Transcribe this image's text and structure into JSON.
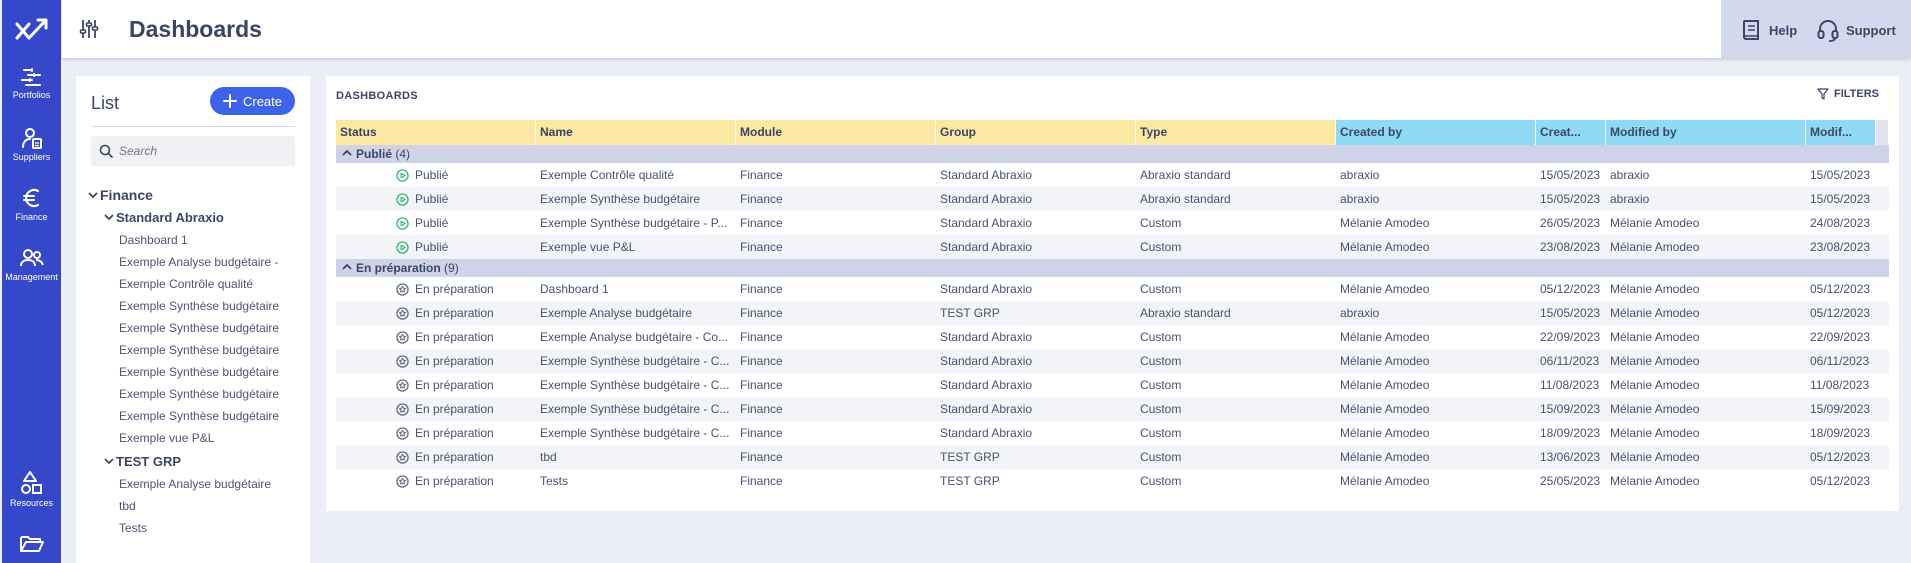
{
  "nav": {
    "items": [
      {
        "label": "Portfolios",
        "icon": "portfolios-icon"
      },
      {
        "label": "Suppliers",
        "icon": "suppliers-icon"
      },
      {
        "label": "Finance",
        "icon": "euro-icon"
      },
      {
        "label": "Management",
        "icon": "people-icon"
      }
    ],
    "bottom": [
      {
        "label": "Resources",
        "icon": "shapes-icon"
      },
      {
        "label": "",
        "icon": "folder-open-icon"
      }
    ]
  },
  "topbar": {
    "title": "Dashboards",
    "help_label": "Help",
    "support_label": "Support"
  },
  "list": {
    "title": "List",
    "create_label": "Create",
    "search_placeholder": "Search",
    "tree": {
      "root": "Finance",
      "groups": [
        {
          "name": "Standard Abraxio",
          "items": [
            "Dashboard 1",
            "Exemple Analyse budgétaire -",
            "Exemple Contrôle qualité",
            "Exemple Synthèse budgétaire",
            "Exemple Synthèse budgétaire",
            "Exemple Synthèse budgétaire",
            "Exemple Synthèse budgétaire",
            "Exemple Synthèse budgétaire",
            "Exemple Synthèse budgétaire",
            "Exemple vue P&L"
          ]
        },
        {
          "name": "TEST GRP",
          "items": [
            "Exemple Analyse budgétaire",
            "tbd",
            "Tests"
          ]
        }
      ]
    }
  },
  "main": {
    "title": "DASHBOARDS",
    "filters_label": "FILTERS",
    "columns": [
      "Status",
      "Name",
      "Module",
      "Group",
      "Type",
      "Created by",
      "Creat...",
      "Modified by",
      "Modif..."
    ],
    "groups": [
      {
        "label": "Publié",
        "count": "(4)",
        "rows": [
          [
            "Publié",
            "Exemple Contrôle qualité",
            "Finance",
            "Standard Abraxio",
            "Abraxio standard",
            "abraxio",
            "15/05/2023",
            "abraxio",
            "15/05/2023"
          ],
          [
            "Publié",
            "Exemple Synthèse budgétaire",
            "Finance",
            "Standard Abraxio",
            "Abraxio standard",
            "abraxio",
            "15/05/2023",
            "abraxio",
            "15/05/2023"
          ],
          [
            "Publié",
            "Exemple Synthèse budgétaire - P...",
            "Finance",
            "Standard Abraxio",
            "Custom",
            "Mélanie Amodeo",
            "26/05/2023",
            "Mélanie Amodeo",
            "24/08/2023"
          ],
          [
            "Publié",
            "Exemple vue P&L",
            "Finance",
            "Standard Abraxio",
            "Custom",
            "Mélanie Amodeo",
            "23/08/2023",
            "Mélanie Amodeo",
            "23/08/2023"
          ]
        ]
      },
      {
        "label": "En préparation",
        "count": "(9)",
        "rows": [
          [
            "En préparation",
            "Dashboard 1",
            "Finance",
            "Standard Abraxio",
            "Custom",
            "Mélanie Amodeo",
            "05/12/2023",
            "Mélanie Amodeo",
            "05/12/2023"
          ],
          [
            "En préparation",
            "Exemple Analyse budgétaire",
            "Finance",
            "TEST GRP",
            "Abraxio standard",
            "abraxio",
            "15/05/2023",
            "Mélanie Amodeo",
            "05/12/2023"
          ],
          [
            "En préparation",
            "Exemple Analyse budgétaire - Co...",
            "Finance",
            "Standard Abraxio",
            "Custom",
            "Mélanie Amodeo",
            "22/09/2023",
            "Mélanie Amodeo",
            "22/09/2023"
          ],
          [
            "En préparation",
            "Exemple Synthèse budgétaire - C...",
            "Finance",
            "Standard Abraxio",
            "Custom",
            "Mélanie Amodeo",
            "06/11/2023",
            "Mélanie Amodeo",
            "06/11/2023"
          ],
          [
            "En préparation",
            "Exemple Synthèse budgétaire - C...",
            "Finance",
            "Standard Abraxio",
            "Custom",
            "Mélanie Amodeo",
            "11/08/2023",
            "Mélanie Amodeo",
            "11/08/2023"
          ],
          [
            "En préparation",
            "Exemple Synthèse budgétaire - C...",
            "Finance",
            "Standard Abraxio",
            "Custom",
            "Mélanie Amodeo",
            "15/09/2023",
            "Mélanie Amodeo",
            "15/09/2023"
          ],
          [
            "En préparation",
            "Exemple Synthèse budgétaire - C...",
            "Finance",
            "Standard Abraxio",
            "Custom",
            "Mélanie Amodeo",
            "18/09/2023",
            "Mélanie Amodeo",
            "18/09/2023"
          ],
          [
            "En préparation",
            "tbd",
            "Finance",
            "TEST GRP",
            "Custom",
            "Mélanie Amodeo",
            "13/06/2023",
            "Mélanie Amodeo",
            "05/12/2023"
          ],
          [
            "En préparation",
            "Tests",
            "Finance",
            "TEST GRP",
            "Custom",
            "Mélanie Amodeo",
            "25/05/2023",
            "Mélanie Amodeo",
            "05/12/2023"
          ]
        ]
      }
    ]
  },
  "colors": {
    "rail": "#3548c9",
    "accent": "#3d63e8",
    "header_yellow": "#fbe8a3",
    "header_blue": "#8fdbf5",
    "published_green": "#2fb36b",
    "prep_gray": "#5a6078"
  }
}
